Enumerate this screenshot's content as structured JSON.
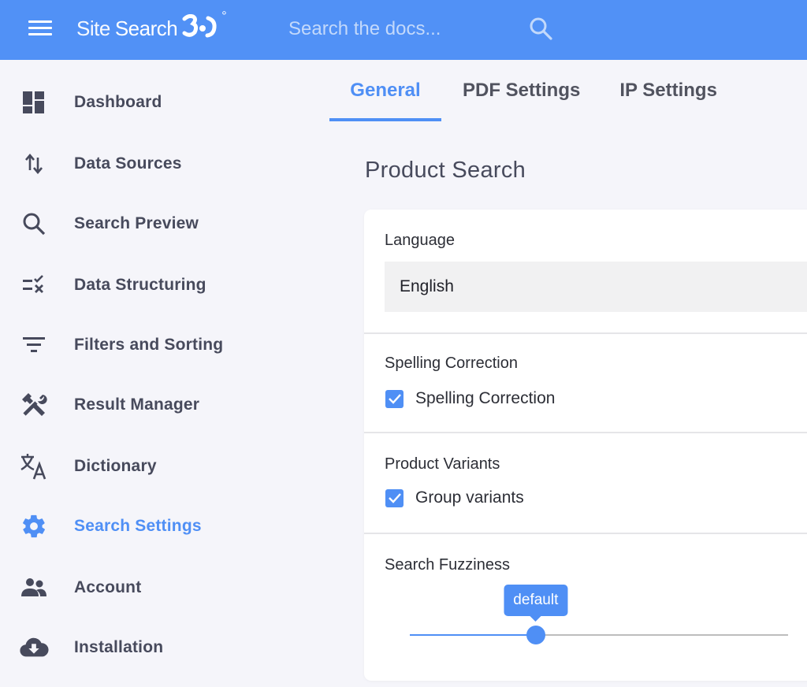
{
  "header": {
    "logo": {
      "site": "Site",
      "search": "Search",
      "number": "30",
      "degree": "°"
    },
    "search": {
      "placeholder": "Search the docs...",
      "value": ""
    },
    "icons": {
      "menu": "hamburger-icon",
      "search": "search-icon"
    }
  },
  "sidebar": {
    "items": [
      {
        "label": "Dashboard",
        "icon": "dashboard-icon",
        "active": false
      },
      {
        "label": "Data Sources",
        "icon": "swap-vertical-icon",
        "active": false
      },
      {
        "label": "Search Preview",
        "icon": "search-icon",
        "active": false
      },
      {
        "label": "Data Structuring",
        "icon": "rule-icon",
        "active": false
      },
      {
        "label": "Filters and Sorting",
        "icon": "filter-icon",
        "active": false
      },
      {
        "label": "Result Manager",
        "icon": "tools-icon",
        "active": false
      },
      {
        "label": "Dictionary",
        "icon": "translate-icon",
        "active": false
      },
      {
        "label": "Search Settings",
        "icon": "gear-icon",
        "active": true
      },
      {
        "label": "Account",
        "icon": "people-icon",
        "active": false
      },
      {
        "label": "Installation",
        "icon": "cloud-download-icon",
        "active": false
      }
    ]
  },
  "tabs": [
    {
      "label": "General",
      "active": true
    },
    {
      "label": "PDF Settings",
      "active": false
    },
    {
      "label": "IP Settings",
      "active": false
    }
  ],
  "main": {
    "title": "Product Search",
    "language": {
      "label": "Language",
      "selected": "English"
    },
    "spelling": {
      "label": "Spelling Correction",
      "checkbox_label": "Spelling Correction",
      "checked": true
    },
    "variants": {
      "label": "Product Variants",
      "checkbox_label": "Group variants",
      "checked": true
    },
    "fuzziness": {
      "label": "Search Fuzziness",
      "value_label": "default",
      "value_fraction": 0.333
    }
  },
  "colors": {
    "brand": "#5191f6",
    "accent": "#4f8ff5",
    "text": "#474a5c",
    "background": "#f5f5fa"
  }
}
